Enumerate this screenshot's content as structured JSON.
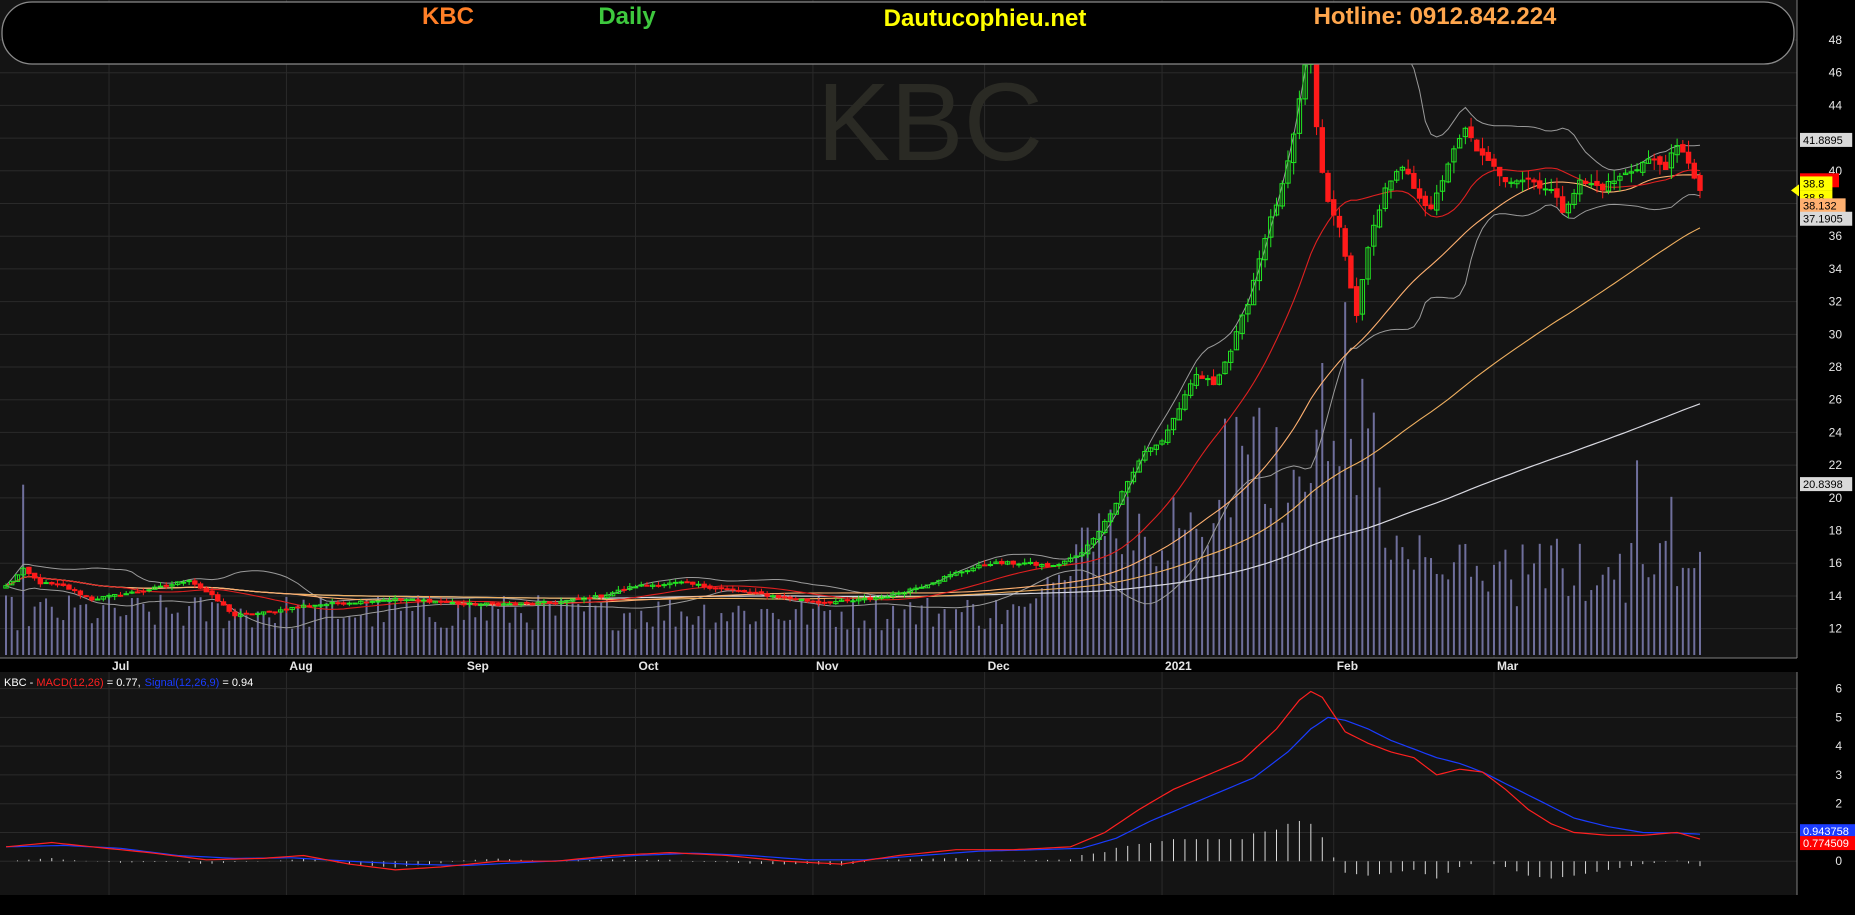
{
  "header": {
    "ticker": "KBC",
    "timeframe": "Daily",
    "site": "Dautucophieu.net",
    "hotline": "Hotline: 0912.842.224"
  },
  "watermark": "KBC",
  "colors": {
    "background": "#000000",
    "panel": "#141414",
    "up_candle": "#22e622",
    "down_candle": "#ff1a1a",
    "ticker_text": "#ff7f27",
    "timeframe_text": "#3ec83e",
    "site_text": "#ffff00",
    "hotline_text": "#ffa64d",
    "ma_short": "#e02020",
    "ma_mid": "#f0b060",
    "ma_long": "#ffb070",
    "ma_longest": "#d8d8e0",
    "bollinger": "#9a9a9a",
    "volume": "#6f6f9c",
    "macd_line": "#ff2020",
    "signal_line": "#1a3cff"
  },
  "chart_data": [
    {
      "type": "candlestick",
      "title": "KBC Daily",
      "x_labels": [
        {
          "label": "Jul",
          "day": 18
        },
        {
          "label": "Aug",
          "day": 49
        },
        {
          "label": "Sep",
          "day": 80
        },
        {
          "label": "Oct",
          "day": 110
        },
        {
          "label": "Nov",
          "day": 141
        },
        {
          "label": "Dec",
          "day": 171
        },
        {
          "label": "2021",
          "day": 202
        },
        {
          "label": "Feb",
          "day": 232
        },
        {
          "label": "Mar",
          "day": 260
        }
      ],
      "ylim": [
        11,
        48
      ],
      "yticks": [
        12,
        14,
        16,
        18,
        20,
        22,
        24,
        26,
        28,
        30,
        32,
        34,
        36,
        38,
        40,
        42,
        44,
        46,
        48
      ],
      "grid": true,
      "price_path": [
        [
          0,
          14.6
        ],
        [
          3,
          15.6
        ],
        [
          6,
          14.8
        ],
        [
          10,
          14.6
        ],
        [
          15,
          13.8
        ],
        [
          22,
          14.2
        ],
        [
          28,
          14.6
        ],
        [
          32,
          15.0
        ],
        [
          36,
          14.0
        ],
        [
          40,
          12.8
        ],
        [
          46,
          13.0
        ],
        [
          52,
          13.4
        ],
        [
          60,
          13.6
        ],
        [
          68,
          13.8
        ],
        [
          74,
          13.7
        ],
        [
          80,
          13.5
        ],
        [
          88,
          13.5
        ],
        [
          96,
          13.6
        ],
        [
          104,
          14.0
        ],
        [
          110,
          14.6
        ],
        [
          118,
          14.8
        ],
        [
          126,
          14.4
        ],
        [
          134,
          14.0
        ],
        [
          138,
          13.8
        ],
        [
          142,
          13.6
        ],
        [
          148,
          13.7
        ],
        [
          154,
          14.0
        ],
        [
          160,
          14.6
        ],
        [
          166,
          15.4
        ],
        [
          172,
          16.0
        ],
        [
          178,
          16.0
        ],
        [
          183,
          15.8
        ],
        [
          188,
          16.6
        ],
        [
          192,
          18.5
        ],
        [
          196,
          21.0
        ],
        [
          199,
          22.8
        ],
        [
          202,
          23.5
        ],
        [
          205,
          25.5
        ],
        [
          208,
          27.5
        ],
        [
          211,
          27.0
        ],
        [
          214,
          29.0
        ],
        [
          217,
          32.0
        ],
        [
          220,
          36.0
        ],
        [
          223,
          39.0
        ],
        [
          225,
          42.0
        ],
        [
          227,
          46.5
        ],
        [
          228,
          47.0
        ],
        [
          229,
          42.5
        ],
        [
          230,
          40.0
        ],
        [
          231,
          38.0
        ],
        [
          233,
          36.5
        ],
        [
          235,
          33.0
        ],
        [
          236,
          31.0
        ],
        [
          238,
          35.5
        ],
        [
          241,
          38.8
        ],
        [
          244,
          40.2
        ],
        [
          247,
          38.5
        ],
        [
          249,
          37.5
        ],
        [
          252,
          40.5
        ],
        [
          255,
          42.5
        ],
        [
          258,
          40.8
        ],
        [
          262,
          39.5
        ],
        [
          266,
          39.5
        ],
        [
          270,
          38.8
        ],
        [
          272,
          37.6
        ],
        [
          275,
          39.3
        ],
        [
          279,
          39.0
        ],
        [
          283,
          39.8
        ],
        [
          287,
          40.7
        ],
        [
          290,
          40.3
        ],
        [
          292,
          41.4
        ],
        [
          294,
          40.6
        ],
        [
          296,
          38.8
        ]
      ],
      "last_close": 38.8,
      "volume_scale_max": 30,
      "overlays": [
        {
          "value": 41.8895,
          "label": "41.8895"
        },
        {
          "value": 39.42,
          "label": "39.42"
        },
        {
          "value": 38.8,
          "label": "38.8"
        },
        {
          "value": 38.8,
          "label": "38.8"
        },
        {
          "value": 38.132,
          "label": "38.132"
        },
        {
          "value": 37.1905,
          "label": "37.1905"
        },
        {
          "value": 20.8398,
          "label": "20.8398"
        }
      ],
      "ma_long_end": 27.5,
      "ma_longest_end": 20.8398
    },
    {
      "type": "line",
      "title": "KBC - MACD(12,26) = 0.77, Signal(12,26,9) = 0.94",
      "legend": {
        "ticker": "KBC",
        "sep": " - ",
        "macd_name": "MACD(12,26)",
        "macd_value": " = 0.77,",
        "signal_name": "Signal(12,26,9)",
        "signal_value": " = 0.94"
      },
      "ylim": [
        -1,
        6.3
      ],
      "yticks": [
        0,
        1,
        2,
        3,
        4,
        5,
        6
      ],
      "macd_path": [
        [
          0,
          0.5
        ],
        [
          8,
          0.65
        ],
        [
          15,
          0.5
        ],
        [
          25,
          0.3
        ],
        [
          35,
          0.05
        ],
        [
          45,
          0.1
        ],
        [
          52,
          0.2
        ],
        [
          60,
          -0.1
        ],
        [
          68,
          -0.3
        ],
        [
          76,
          -0.2
        ],
        [
          86,
          0.0
        ],
        [
          96,
          0.0
        ],
        [
          106,
          0.2
        ],
        [
          116,
          0.3
        ],
        [
          126,
          0.2
        ],
        [
          136,
          0.0
        ],
        [
          146,
          -0.1
        ],
        [
          156,
          0.2
        ],
        [
          166,
          0.4
        ],
        [
          176,
          0.4
        ],
        [
          186,
          0.5
        ],
        [
          192,
          1.0
        ],
        [
          198,
          1.8
        ],
        [
          204,
          2.5
        ],
        [
          210,
          3.0
        ],
        [
          216,
          3.5
        ],
        [
          222,
          4.6
        ],
        [
          226,
          5.6
        ],
        [
          228,
          5.9
        ],
        [
          230,
          5.7
        ],
        [
          234,
          4.5
        ],
        [
          238,
          4.1
        ],
        [
          242,
          3.8
        ],
        [
          246,
          3.6
        ],
        [
          250,
          3.0
        ],
        [
          254,
          3.2
        ],
        [
          258,
          3.1
        ],
        [
          262,
          2.5
        ],
        [
          266,
          1.8
        ],
        [
          270,
          1.3
        ],
        [
          274,
          1.0
        ],
        [
          280,
          0.9
        ],
        [
          286,
          0.9
        ],
        [
          292,
          1.0
        ],
        [
          296,
          0.77
        ]
      ],
      "signal_path": [
        [
          0,
          0.5
        ],
        [
          10,
          0.55
        ],
        [
          20,
          0.45
        ],
        [
          30,
          0.2
        ],
        [
          40,
          0.1
        ],
        [
          50,
          0.12
        ],
        [
          60,
          0.0
        ],
        [
          70,
          -0.1
        ],
        [
          80,
          -0.15
        ],
        [
          90,
          -0.05
        ],
        [
          100,
          0.05
        ],
        [
          110,
          0.2
        ],
        [
          120,
          0.28
        ],
        [
          130,
          0.2
        ],
        [
          140,
          0.05
        ],
        [
          150,
          0.05
        ],
        [
          160,
          0.2
        ],
        [
          170,
          0.35
        ],
        [
          180,
          0.4
        ],
        [
          188,
          0.45
        ],
        [
          194,
          0.8
        ],
        [
          200,
          1.4
        ],
        [
          206,
          1.9
        ],
        [
          212,
          2.4
        ],
        [
          218,
          2.9
        ],
        [
          224,
          3.8
        ],
        [
          228,
          4.6
        ],
        [
          231,
          5.0
        ],
        [
          234,
          4.9
        ],
        [
          238,
          4.6
        ],
        [
          242,
          4.2
        ],
        [
          246,
          3.9
        ],
        [
          250,
          3.6
        ],
        [
          254,
          3.4
        ],
        [
          258,
          3.1
        ],
        [
          262,
          2.7
        ],
        [
          266,
          2.3
        ],
        [
          270,
          1.9
        ],
        [
          274,
          1.5
        ],
        [
          280,
          1.2
        ],
        [
          286,
          1.0
        ],
        [
          292,
          0.98
        ],
        [
          296,
          0.94
        ]
      ],
      "overlays": [
        {
          "value": 0.94,
          "label": "0.943758"
        },
        {
          "value": 0.77,
          "label": "0.774509"
        }
      ]
    }
  ]
}
